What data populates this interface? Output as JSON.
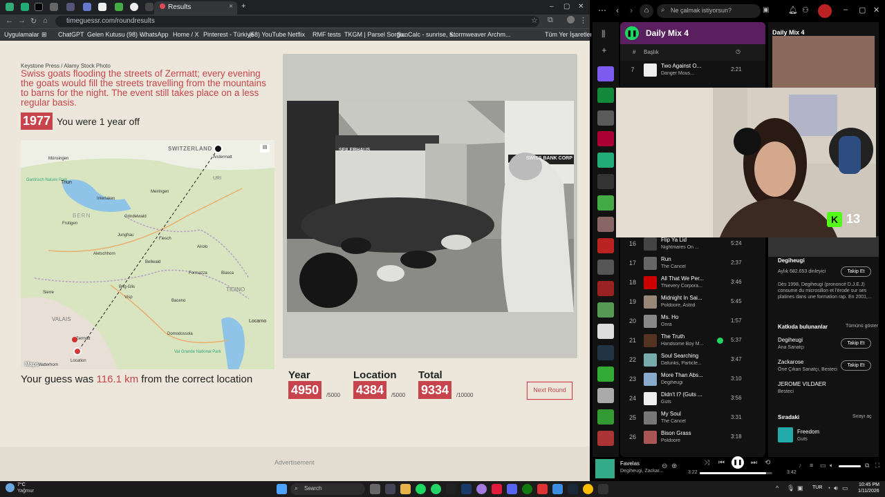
{
  "tabs": {
    "active": "Results",
    "new_tab": "+"
  },
  "address": {
    "url": "timeguessr.com/roundresults"
  },
  "bookmarks": [
    "Uygulamalar",
    "ChatGPT",
    "Gelen Kutusu (98) -...",
    "WhatsApp",
    "Home / X",
    "Pinterest - Türkiye",
    "(58) YouTube",
    "Netflix",
    "RMF tests",
    "TKGM | Parsel Sorgu...",
    "SunCalc - sunrise, s...",
    "Stormweaver Archm...",
    "Tüm Yer İşaretleri"
  ],
  "result": {
    "credit": "Keystone Press / Alamy Stock Photo",
    "caption": "Swiss goats flooding the streets of Zermatt; every evening the goats would fill the streets travelling from the mountains to barns for the night. The event still takes place on a less regular basis.",
    "year": "1977",
    "year_feedback": "You were 1 year off",
    "guess_prefix": "Your guess was ",
    "guess_km": "116.1 km",
    "guess_suffix": " from the correct location",
    "next_round": "Next Round",
    "advertisement": "Advertisement"
  },
  "map": {
    "country": "SWITZERLAND",
    "region_labels": [
      "BERN",
      "VALAIS",
      "TICINO",
      "URI"
    ],
    "towns": [
      "Münsingen",
      "Gantrisch Nature Park",
      "Thun",
      "Interlaken",
      "Frutigen",
      "Grindelwald",
      "Meiringen",
      "Andermatt",
      "Jungfrau",
      "Fiesch",
      "Aletschhorn",
      "Brig-Glis",
      "Sierre",
      "Visp",
      "Zermatt",
      "Domodossola",
      "Locarno",
      "Bellwald",
      "Airolo",
      "Formazza",
      "Baceno",
      "Biasca",
      "Val Grande National Park",
      "Matterhorn",
      "Location"
    ],
    "attribution": "Maps"
  },
  "scores": [
    {
      "label": "Year",
      "value": "4950",
      "max": "/5000"
    },
    {
      "label": "Location",
      "value": "4384",
      "max": "/5000"
    },
    {
      "label": "Total",
      "value": "9334",
      "max": "/10000"
    }
  ],
  "photo": {
    "storefront_left": "SEILERHAUS",
    "storefront_right": "SWISS BANK CORP"
  },
  "spotify": {
    "search_placeholder": "Ne çalmak istiyorsun?",
    "playlist": "Daily Mix 4",
    "col_title": "Başlık",
    "tracks": [
      {
        "n": "7",
        "name": "Two Against O...",
        "artist": "Danger Mous...",
        "dur": "2:21",
        "art": "#eee"
      },
      {
        "n": "16",
        "name": "Flip Ya Lid",
        "artist": "Nightmares On ...",
        "dur": "5:24",
        "art": "#444"
      },
      {
        "n": "17",
        "name": "Run",
        "artist": "The Cancel",
        "dur": "2:37",
        "art": "#666"
      },
      {
        "n": "18",
        "name": "All That We Per...",
        "artist": "Thievery Corpora...",
        "dur": "3:46",
        "art": "#c00"
      },
      {
        "n": "19",
        "name": "Midnight In Sai...",
        "artist": "Poldoore, Astrid",
        "dur": "5:45",
        "art": "#998877"
      },
      {
        "n": "20",
        "name": "Ms. Ho",
        "artist": "Onra",
        "dur": "1:57",
        "art": "#888"
      },
      {
        "n": "21",
        "name": "The Truth",
        "artist": "Handsome Boy M...",
        "dur": "5:37",
        "art": "#553322",
        "liked": true
      },
      {
        "n": "22",
        "name": "Soul Searching",
        "artist": "Dafunks, Particle...",
        "dur": "3:47",
        "art": "#7aa"
      },
      {
        "n": "23",
        "name": "More Than Abs...",
        "artist": "Degiheugi",
        "dur": "3:10",
        "art": "#8ac"
      },
      {
        "n": "24",
        "name": "Didn't I? (Guts ...",
        "artist": "Guts",
        "dur": "3:56",
        "art": "#eee"
      },
      {
        "n": "25",
        "name": "My Soul",
        "artist": "The Cancel",
        "dur": "3:31",
        "art": "#777"
      },
      {
        "n": "26",
        "name": "Bison Grass",
        "artist": "Poldoore",
        "dur": "3:18",
        "art": "#a55"
      }
    ],
    "right": {
      "title": "Daily Mix 4",
      "artist": "Degiheugi",
      "listeners": "Aylık 682.653 dinleyici",
      "follow": "Takip Et",
      "bio": "Dès 1998, Degiheugi (prononcé D.J.E.J) consume du microsillon et l'érode sur ses platines dans une formation rap. En 2001,...",
      "credits_title": "Katkıda bulunanlar",
      "show_all": "Tümünü göster",
      "credits": [
        {
          "name": "Degiheugi",
          "role": "Ana Sanatçı"
        },
        {
          "name": "Zackarose",
          "role": "Öne Çıkan Sanatçı, Besteci"
        },
        {
          "name": "JEROME VILDAER",
          "role": "Besteci"
        }
      ],
      "queue_title": "Sıradaki",
      "queue_open": "Sırayı aç",
      "next_track": "Freedom",
      "next_artist": "Guts"
    },
    "player": {
      "track": "Favelas",
      "artist": "Degiheugi, Zackar...",
      "elapsed": "3:22",
      "total": "3:42",
      "progress": 0.91
    }
  },
  "stream": {
    "kick_count": "13"
  },
  "taskbar": {
    "weather_temp": "7°C",
    "weather_desc": "Yağmur",
    "search": "Search",
    "lang": "TUR",
    "time": "10:45 PM",
    "date": "1/11/2026"
  },
  "colors": {
    "accent": "#c8444c",
    "spotify_green": "#1ed760",
    "header": "#5a1f5e"
  }
}
